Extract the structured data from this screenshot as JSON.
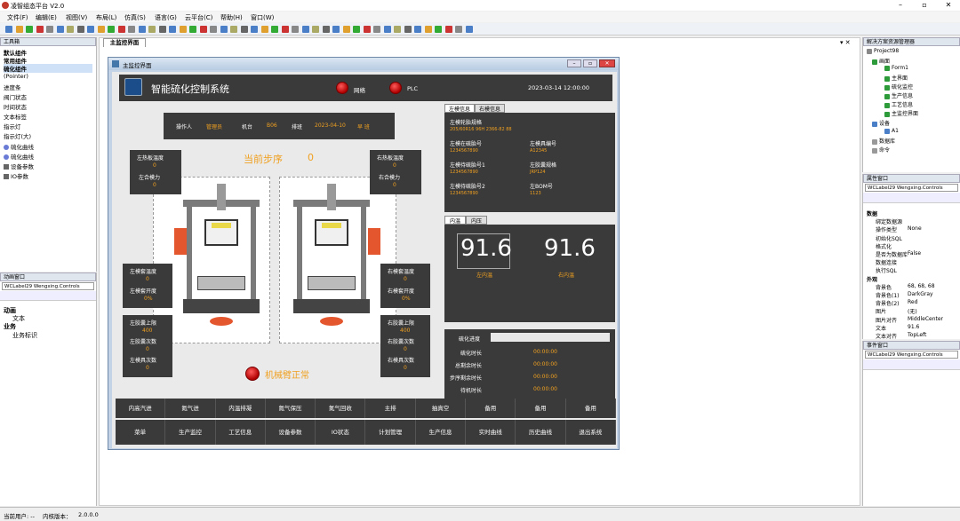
{
  "app": {
    "title": "凌智组态平台 V2.0"
  },
  "menu": [
    "文件(F)",
    "编辑(E)",
    "视图(V)",
    "布局(L)",
    "仿真(S)",
    "语言(G)",
    "云平台(C)",
    "帮助(H)",
    "窗口(W)"
  ],
  "toolbox": {
    "title": "工具箱",
    "items": [
      "默认组件",
      "常用组件",
      "硫化组件",
      "(Pointer)",
      "进度条",
      "阀门状态",
      "时间状态",
      "文本标签",
      "指示灯",
      "指示灯(大)",
      "硫化曲线",
      "硫化曲线",
      "设备参数",
      "IO参数"
    ]
  },
  "anim": {
    "title": "动画窗口",
    "combo": "WCLabel29 Wengxing.Controls",
    "rows": [
      "动画",
      "文本",
      "业务",
      "业务标识"
    ]
  },
  "doc": {
    "tab": "主监控界面",
    "inner_title": "主监控界面"
  },
  "scada": {
    "system_name": "智能硫化控制系统",
    "net_label": "网络",
    "plc_label": "PLC",
    "datetime": "2023-03-14 12:00:00",
    "op_label": "操作人",
    "op_value": "管理员",
    "machine_label": "机台",
    "machine_value": "B06",
    "shift_label": "排班",
    "shift_date": "2023-04-10",
    "shift_value": "早 班",
    "step_label": "当前步序",
    "step_value": "0",
    "left_hot_label": "左热板温度",
    "left_hot_val": "0",
    "left_force_label": "左合模力",
    "left_force_val": "0",
    "right_hot_label": "右热板温度",
    "right_hot_val": "0",
    "right_force_label": "右合模力",
    "right_force_val": "0",
    "left_jacket_label": "左模套温度",
    "left_jacket_val": "0",
    "left_jacket_open_label": "左模套开度",
    "left_jacket_open_val": "0%",
    "right_jacket_label": "右模套温度",
    "right_jacket_val": "0",
    "right_jacket_open_label": "右模套开度",
    "right_jacket_open_val": "0%",
    "left_cap_label": "左胶囊上限",
    "left_cap_val": "400",
    "left_cap_cnt_label": "左胶囊次数",
    "left_cap_cnt_val": "0",
    "left_mold_label": "左模具次数",
    "left_mold_val": "0",
    "right_cap_label": "右胶囊上限",
    "right_cap_val": "400",
    "right_cap_cnt_label": "右胶囊次数",
    "right_cap_cnt_val": "0",
    "right_mold_label": "右模具次数",
    "right_mold_val": "0",
    "arm_status": "机械臂正常",
    "info_tabs": [
      "左模信息",
      "右模信息"
    ],
    "info": {
      "spec_label": "左模轮胎规格",
      "spec_val": "205/60R16 96H 2366-82 88",
      "barcode_label": "左模在硫胎号",
      "barcode_val": "1234567890",
      "mold_label": "左模具编号",
      "mold_val": "A12345",
      "pending_label": "左模待硫胎号1",
      "pending_val": "1234567890",
      "bladder_label": "左胶囊规格",
      "bladder_val": "JRP124",
      "pending2_label": "左模待硫胎号2",
      "pending2_val": "1234567890",
      "bom_label": "左BOM号",
      "bom_val": "1123"
    },
    "temp_tabs": [
      "内温",
      "内压"
    ],
    "left_temp": "91.6",
    "left_temp_label": "左内温",
    "right_temp": "91.6",
    "right_temp_label": "右内温",
    "progress_label": "硫化进度",
    "cure_time_label": "硫化时长",
    "cure_time_val": "00:00:00",
    "remain_label": "总剩余时长",
    "remain_val": "00:00:00",
    "step_remain_label": "步序剩余时长",
    "step_remain_val": "00:00:00",
    "wait_label": "待机时长",
    "wait_val": "00:00:00",
    "row1": [
      "内高汽进",
      "氮气进",
      "内温排凝",
      "氮气保压",
      "氮气回收",
      "主排",
      "抽真空",
      "备用",
      "备用",
      "备用"
    ],
    "row2": [
      "菜单",
      "生产监控",
      "工艺信息",
      "设备参数",
      "IO状态",
      "计划管理",
      "生产信息",
      "实时曲线",
      "历史曲线",
      "退出系统"
    ]
  },
  "solution": {
    "title": "解决方案资源管理器",
    "items": [
      "Project98",
      "画面",
      "Form1",
      "主界面",
      "硫化监控",
      "生产信息",
      "工艺信息",
      "主监控界面",
      "设备",
      "A1",
      "数据库",
      "命令"
    ]
  },
  "props": {
    "title": "属性窗口",
    "combo": "WCLabel29 Wengxing.Controls",
    "rows": [
      [
        "数据",
        ""
      ],
      [
        "绑定数据源",
        ""
      ],
      [
        "操作类型",
        "None"
      ],
      [
        "初始化SQL",
        ""
      ],
      [
        "格式化",
        ""
      ],
      [
        "是否为数据库",
        "False"
      ],
      [
        "数据连接",
        ""
      ],
      [
        "执行SQL",
        ""
      ],
      [
        "外观",
        ""
      ],
      [
        "背景色",
        "68, 68, 68"
      ],
      [
        "背景色(1)",
        "DarkGray"
      ],
      [
        "背景色(2)",
        "Red"
      ],
      [
        "图片",
        "(无)"
      ],
      [
        "图片对齐",
        "MiddleCenter"
      ],
      [
        "文本",
        "91.6"
      ],
      [
        "文本对齐",
        "TopLeft"
      ]
    ]
  },
  "events": {
    "title": "事件窗口",
    "combo": "WCLabel29 Wengxing.Controls"
  },
  "status": {
    "user": "当前用户: --",
    "version_label": "内核版本：",
    "version": "2.0.0.0"
  }
}
